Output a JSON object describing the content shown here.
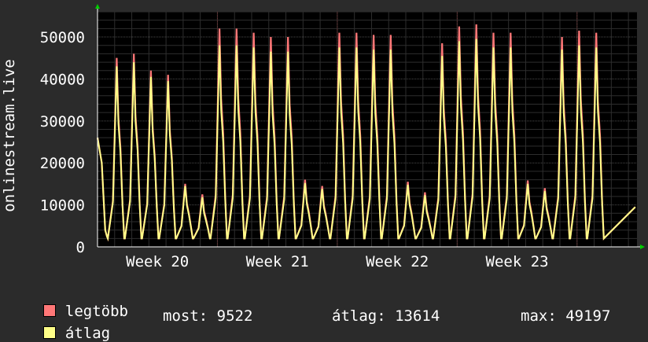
{
  "chart_data": {
    "type": "line",
    "ylabel": "onlinestream.live",
    "ylim": [
      0,
      56000
    ],
    "yticks": [
      0,
      10000,
      20000,
      30000,
      40000,
      50000
    ],
    "ytick_labels": [
      "0",
      "10000",
      "20000",
      "30000",
      "40000",
      "50000"
    ],
    "x_range_days": [
      0,
      31.5
    ],
    "week_labels": [
      "Week 20",
      "Week 21",
      "Week 22",
      "Week 23"
    ],
    "week_label_days": [
      3.5,
      10.5,
      17.5,
      24.5
    ],
    "grid": true,
    "colors": {
      "background": "#2b2b2b",
      "plot": "#000000",
      "grid": "#4a4a4a",
      "max_series": "#ff7777",
      "avg_series": "#ffff88",
      "axis_arrow": "#00cc00"
    },
    "daily_peaks_max": [
      45000,
      46000,
      42000,
      41000,
      15000,
      12500,
      52000,
      52000,
      51000,
      50000,
      50000,
      16000,
      14500,
      51000,
      51000,
      50500,
      50500,
      15500,
      13000,
      48500,
      52500,
      53000,
      51000,
      51000,
      15800,
      14000,
      50000,
      51500,
      51000
    ],
    "daily_peaks_avg": [
      43000,
      44000,
      40500,
      39500,
      14500,
      11800,
      48000,
      48000,
      47500,
      46500,
      46500,
      15200,
      13800,
      47500,
      47500,
      47000,
      47000,
      14800,
      12300,
      45500,
      49000,
      49500,
      47500,
      47500,
      15000,
      13300,
      47000,
      48000,
      47500
    ],
    "series": [
      {
        "name": "legtöbb",
        "color": "#ff7777"
      },
      {
        "name": "átlag",
        "color": "#ffff88"
      }
    ]
  },
  "legend": {
    "max_label": "legtöbb",
    "avg_label": "átlag",
    "most": "most: 9522",
    "atlag": "átlag: 13614",
    "max": "max: 49197"
  }
}
